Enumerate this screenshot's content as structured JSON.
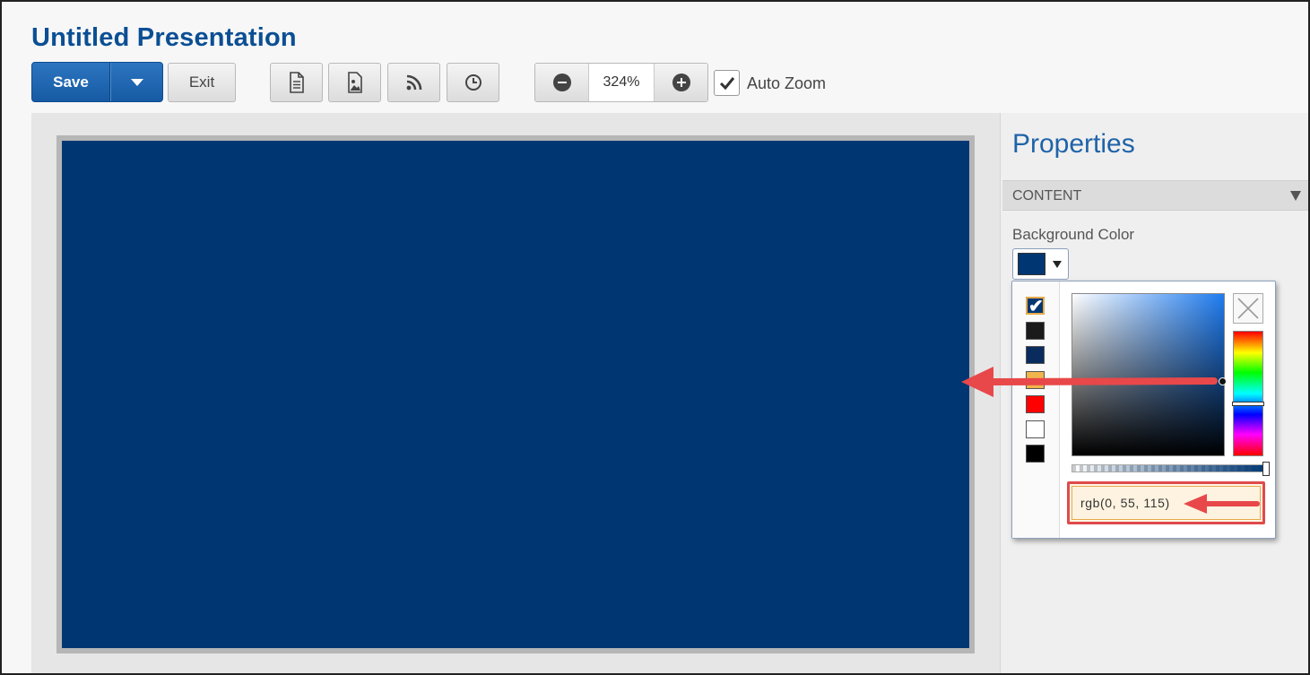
{
  "app": {
    "title": "Untitled Presentation"
  },
  "toolbar": {
    "save_label": "Save",
    "exit_label": "Exit",
    "icons": [
      "document-icon",
      "image-icon",
      "rss-icon",
      "clock-icon"
    ],
    "zoom_value": "324%",
    "auto_zoom_label": "Auto Zoom",
    "auto_zoom_checked": true
  },
  "canvas": {
    "background_color": "#003773"
  },
  "properties": {
    "title": "Properties",
    "section_label": "CONTENT",
    "background_color_label": "Background Color",
    "current_color": "#003773"
  },
  "color_picker": {
    "palette": [
      {
        "color": "#003773",
        "selected": true
      },
      {
        "color": "#1a1a1a",
        "selected": false
      },
      {
        "color": "#0a2b5e",
        "selected": false
      },
      {
        "color": "#f0b64b",
        "selected": false
      },
      {
        "color": "#ff0000",
        "selected": false
      },
      {
        "color": "#ffffff",
        "selected": false
      },
      {
        "color": "#000000",
        "selected": false
      }
    ],
    "value": "rgb(0, 55, 115)",
    "alpha": 1.0
  },
  "colors": {
    "brand": "#0b4f94",
    "save_button": "#1f66b3",
    "annotation": "#e04a4a"
  }
}
